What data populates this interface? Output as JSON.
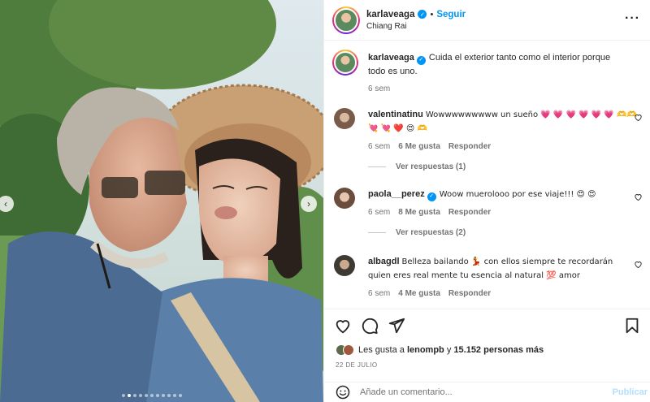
{
  "post": {
    "username": "karlaveaga",
    "separator": "•",
    "follow_label": "Seguir",
    "location": "Chiang Rai",
    "more_icon": "more-horizontal-icon"
  },
  "caption": {
    "username": "karlaveaga",
    "text": "Cuida el exterior tanto como el interior porque todo es uno.",
    "age": "6 sem"
  },
  "comments": [
    {
      "username": "valentinatinu",
      "text": "Wowwwwwwwww un sueño 💗 💗 💗 💗 💗 💗 🫶🫶",
      "text2": "💘 💘 ❤️ 😍 🫶",
      "age": "6 sem",
      "likes": "6 Me gusta",
      "reply_label": "Responder",
      "view_replies": "Ver respuestas (1)"
    },
    {
      "username": "paola__perez",
      "text": "Woow muerolooo por ese viaje!!! 😍 😍",
      "age": "6 sem",
      "likes": "8 Me gusta",
      "reply_label": "Responder",
      "view_replies": "Ver respuestas (2)"
    },
    {
      "username": "albagdl",
      "text": "Belleza bailando 💃 con ellos siempre te recordarán quien eres real mente tu esencia al natural 💯 amor",
      "age": "6 sem",
      "likes": "4 Me gusta",
      "reply_label": "Responder"
    }
  ],
  "likes": {
    "prefix": "Les gusta a",
    "user": "lenompb",
    "conj": "y",
    "count": "15.152 personas más"
  },
  "date": "22 DE JULIO",
  "composer": {
    "placeholder": "Añade un comentario...",
    "publish_label": "Publicar"
  },
  "colors": {
    "accent": "#0095f6",
    "publish_disabled": "#b2dffc",
    "text": "#262626",
    "muted": "#737373"
  }
}
